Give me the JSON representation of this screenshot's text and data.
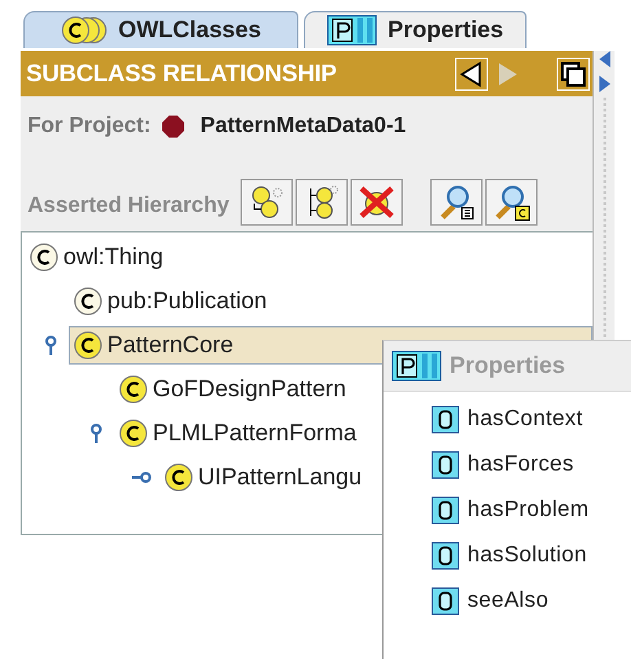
{
  "tabs": [
    {
      "label": "OWLClasses",
      "kind": "class",
      "selected": true
    },
    {
      "label": "Properties",
      "kind": "property",
      "selected": false
    }
  ],
  "header": {
    "title": "SUBCLASS RELATIONSHIP",
    "back_enabled": true,
    "forward_enabled": false
  },
  "project": {
    "label": "For Project:",
    "name": "PatternMetaData0-1"
  },
  "hierarchy": {
    "label": "Asserted Hierarchy",
    "tools": [
      {
        "kind": "create"
      },
      {
        "kind": "create-sibling"
      },
      {
        "kind": "delete"
      },
      {
        "kind": "find-restriction"
      },
      {
        "kind": "find-class"
      }
    ],
    "tree": [
      {
        "label": "owl:Thing",
        "kind": "imported",
        "selected": false,
        "children": [
          {
            "label": "pub:Publication",
            "kind": "imported",
            "selected": false
          },
          {
            "label": "PatternCore",
            "kind": "local",
            "selected": true,
            "expanded": true,
            "children": [
              {
                "label": "GoFDesignPattern",
                "kind": "local",
                "selected": false
              },
              {
                "label": "PLMLPatternForma",
                "kind": "local",
                "selected": false,
                "expanded": true,
                "children": [
                  {
                    "label": "UIPatternLangu",
                    "kind": "local",
                    "selected": false,
                    "expanded": false
                  }
                ]
              }
            ]
          }
        ]
      }
    ]
  },
  "popup": {
    "title": "Properties",
    "items": [
      {
        "label": "hasContext"
      },
      {
        "label": "hasForces"
      },
      {
        "label": "hasProblem"
      },
      {
        "label": "hasSolution"
      },
      {
        "label": "seeAlso"
      }
    ]
  }
}
